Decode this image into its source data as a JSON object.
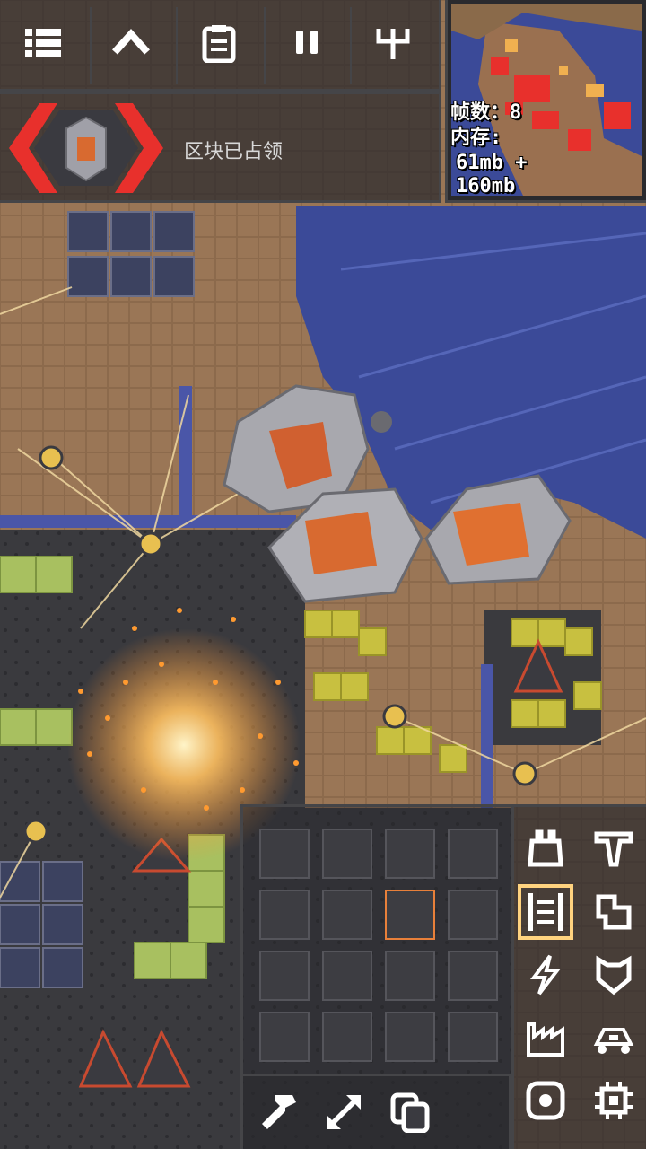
{
  "hud": {
    "menu_icon": "menu-icon",
    "up_icon": "chevron-up-icon",
    "database_icon": "clipboard-icon",
    "pause_icon": "pause-icon",
    "tech_icon": "tech-tree-icon"
  },
  "core_info": {
    "status": "区块已占领"
  },
  "stats": {
    "fps_label": "帧数：8",
    "memory_label": "内存:",
    "memory_line1": "61mb +",
    "memory_line2": "160mb"
  },
  "build_categories": [
    {
      "name": "turret",
      "icon": "turret-icon",
      "selected": false
    },
    {
      "name": "production",
      "icon": "drill-icon",
      "selected": false
    },
    {
      "name": "distribution",
      "icon": "conveyor-icon",
      "selected": true
    },
    {
      "name": "liquid",
      "icon": "liquid-icon",
      "selected": false
    },
    {
      "name": "power",
      "icon": "lightning-icon",
      "selected": false
    },
    {
      "name": "defense",
      "icon": "shield-icon",
      "selected": false
    },
    {
      "name": "crafting",
      "icon": "factory-icon",
      "selected": false
    },
    {
      "name": "units",
      "icon": "unit-icon",
      "selected": false
    },
    {
      "name": "effect",
      "icon": "core-icon",
      "selected": false
    },
    {
      "name": "logic",
      "icon": "chip-icon",
      "selected": false
    }
  ],
  "tools": [
    {
      "name": "hammer",
      "icon": "hammer-icon"
    },
    {
      "name": "expand",
      "icon": "expand-icon"
    },
    {
      "name": "copy",
      "icon": "copy-icon"
    }
  ],
  "colors": {
    "accent": "#ffd37f",
    "enemy": "#e8302c",
    "water": "#3c4c9a",
    "sand": "#b08060"
  }
}
